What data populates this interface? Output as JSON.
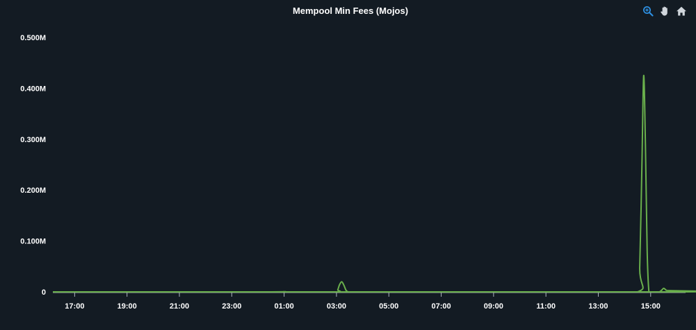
{
  "chart_data": {
    "type": "line",
    "title": "Mempool Min Fees (Mojos)",
    "xlabel": "",
    "ylabel": "",
    "x_axis_type": "datetime",
    "xlim": [
      "16:10",
      "16:20+1d"
    ],
    "ylim": [
      0,
      500000
    ],
    "x_ticks": [
      "17:00",
      "19:00",
      "21:00",
      "23:00",
      "01:00",
      "03:00",
      "05:00",
      "07:00",
      "09:00",
      "11:00",
      "13:00",
      "15:00"
    ],
    "y_ticks": [
      "0",
      "0.100M",
      "0.200M",
      "0.300M",
      "0.400M",
      "0.500M"
    ],
    "y_tick_values": [
      0,
      100000,
      200000,
      300000,
      400000,
      500000
    ],
    "grid": false,
    "legend": "none",
    "series": [
      {
        "color": "#6ab04c",
        "x": [
          "16:10",
          "00:00",
          "01:00",
          "01:10",
          "03:00",
          "03:03",
          "03:07",
          "03:12",
          "03:17",
          "03:22",
          "03:27",
          "03:35",
          "06:00",
          "09:00",
          "12:00",
          "14:30",
          "14:35",
          "14:40",
          "14:44",
          "14:48",
          "14:52",
          "14:56",
          "15:00",
          "15:10",
          "15:20",
          "15:26",
          "15:30",
          "15:36",
          "15:42",
          "16:20"
        ],
        "values": [
          0,
          0,
          300,
          0,
          0,
          4000,
          14000,
          20000,
          13000,
          3000,
          0,
          0,
          0,
          0,
          0,
          0,
          50000,
          250000,
          425000,
          290000,
          80000,
          0,
          0,
          0,
          0,
          4000,
          7000,
          3000,
          0,
          0
        ]
      }
    ]
  },
  "toolbar": {
    "zoom_icon": "zoom-in-icon",
    "pan_icon": "pan-hand-icon",
    "reset_icon": "home-icon",
    "accent_color": "#2d8fe0",
    "muted_color": "#d0d6dc"
  }
}
